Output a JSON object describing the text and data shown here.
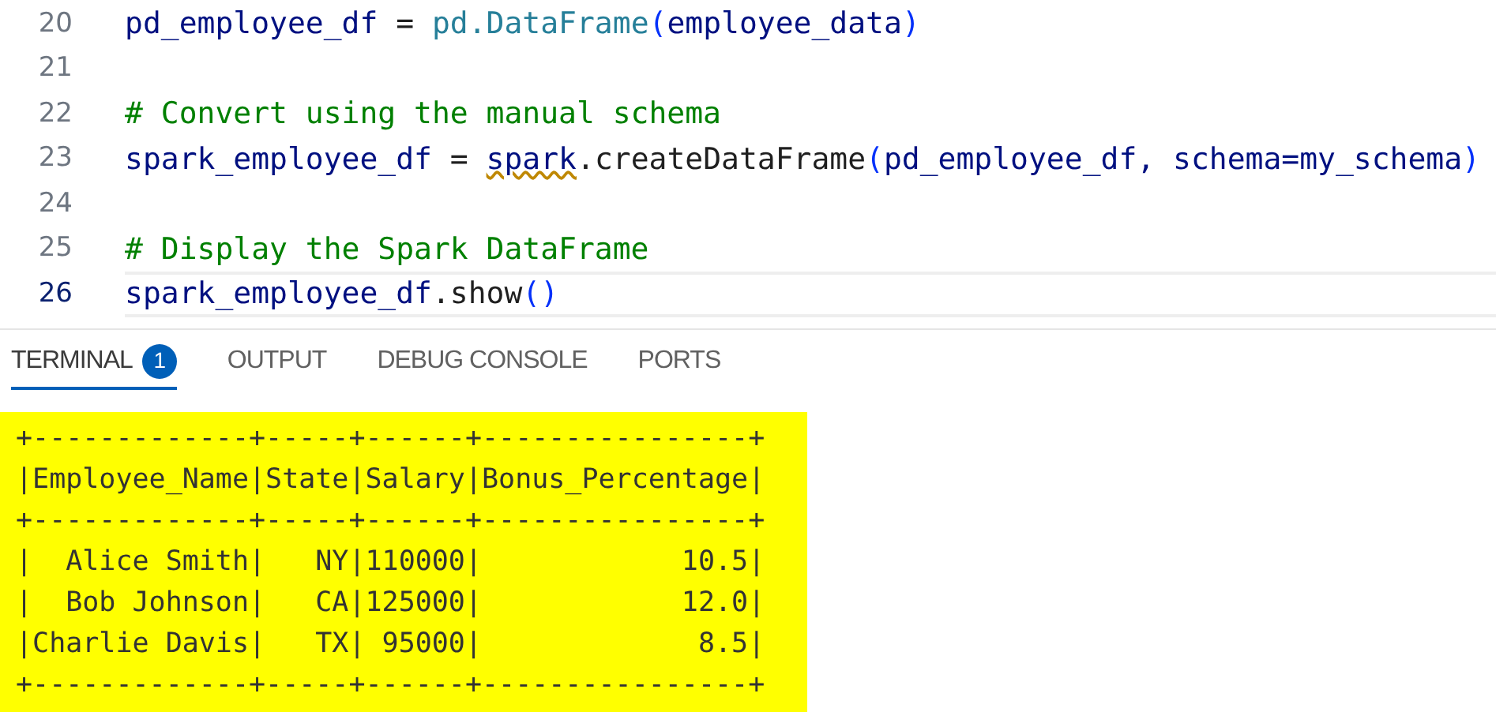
{
  "editor": {
    "lines": [
      {
        "number": "20",
        "current": false,
        "tokens": [
          {
            "kind": "var",
            "text": "pd_employee_df"
          },
          {
            "kind": "plain",
            "text": " = "
          },
          {
            "kind": "type",
            "text": "pd.DataFrame"
          },
          {
            "kind": "paren",
            "text": "("
          },
          {
            "kind": "var",
            "text": "employee_data"
          },
          {
            "kind": "paren",
            "text": ")"
          }
        ]
      },
      {
        "number": "21",
        "current": false
      },
      {
        "number": "22",
        "current": false,
        "tokens": [
          {
            "kind": "comment",
            "text": "# Convert using the manual schema"
          }
        ]
      },
      {
        "number": "23",
        "current": false,
        "tokens": [
          {
            "kind": "var",
            "text": "spark_employee_df"
          },
          {
            "kind": "plain",
            "text": " = "
          },
          {
            "kind": "warn",
            "text": "spark"
          },
          {
            "kind": "plain",
            "text": ".createDataFrame"
          },
          {
            "kind": "paren",
            "text": "("
          },
          {
            "kind": "var",
            "text": "pd_employee_df, schema=my_schema"
          },
          {
            "kind": "paren",
            "text": ")"
          }
        ]
      },
      {
        "number": "24",
        "current": false
      },
      {
        "number": "25",
        "current": false,
        "tokens": [
          {
            "kind": "comment",
            "text": "# Display the Spark DataFrame"
          }
        ]
      },
      {
        "number": "26",
        "current": true,
        "tokens": [
          {
            "kind": "var",
            "text": "spark_employee_df"
          },
          {
            "kind": "plain",
            "text": ".show"
          },
          {
            "kind": "paren",
            "text": "()"
          }
        ]
      }
    ]
  },
  "panel": {
    "tabs": [
      {
        "label": "TERMINAL",
        "selected": true,
        "badge": "1"
      },
      {
        "label": "OUTPUT",
        "selected": false
      },
      {
        "label": "DEBUG CONSOLE",
        "selected": false
      },
      {
        "label": "PORTS",
        "selected": false
      }
    ],
    "output": {
      "highlighted": true,
      "lines": [
        "+-------------+-----+------+----------------+",
        "|Employee_Name|State|Salary|Bonus_Percentage|",
        "+-------------+-----+------+----------------+",
        "|  Alice Smith|   NY|110000|            10.5|",
        "|  Bob Johnson|   CA|125000|            12.0|",
        "|Charlie Davis|   TX| 95000|             8.5|",
        "+-------------+-----+------+----------------+"
      ]
    }
  }
}
